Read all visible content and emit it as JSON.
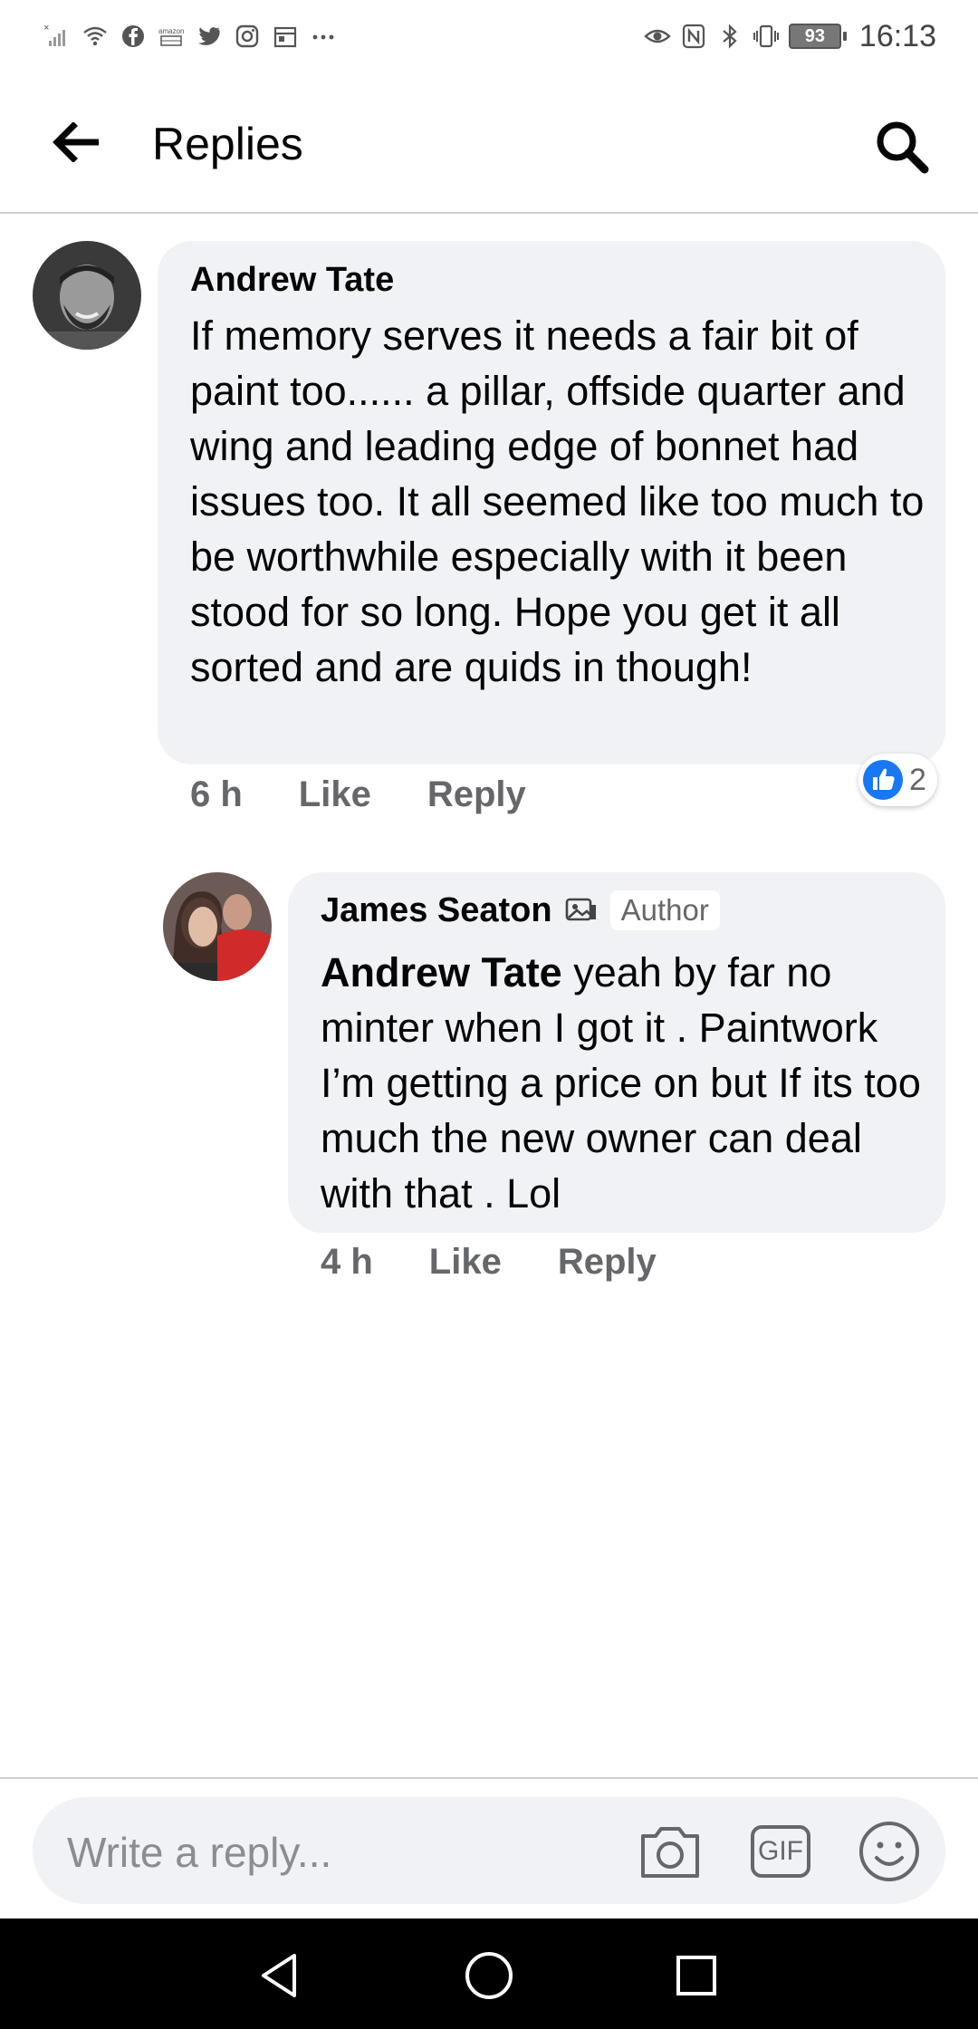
{
  "status_bar": {
    "time": "16:13",
    "battery": "93",
    "left_icons": [
      "signal-off-icon",
      "wifi-icon",
      "facebook-icon",
      "amazon-icon",
      "twitter-icon",
      "instagram-icon",
      "calendar-icon",
      "more-dots-icon"
    ],
    "right_icons": [
      "eye-icon",
      "nfc-icon",
      "bluetooth-icon",
      "vibrate-icon",
      "battery-icon"
    ]
  },
  "header": {
    "title": "Replies",
    "back_icon": "arrow-left-icon",
    "search_icon": "search-icon"
  },
  "comments": [
    {
      "author": "Andrew Tate",
      "text": "If memory serves it needs a fair bit of paint too...... a pillar, offside quarter and wing and leading edge of bonnet had issues too. It all seemed like too much to be worthwhile especially with it been stood for so long. Hope you get it all sorted and are quids in though!",
      "time": "6 h",
      "like_label": "Like",
      "reply_label": "Reply",
      "reaction_count": "2"
    },
    {
      "author": "James Seaton",
      "badge": "Author",
      "mention": "Andrew Tate",
      "text": " yeah by far no minter when I got it . Paintwork I’m getting a price on but If its too much the new owner can deal with that . Lol",
      "time": "4 h",
      "like_label": "Like",
      "reply_label": "Reply"
    }
  ],
  "composer": {
    "placeholder": "Write a reply...",
    "gif_label": "GIF"
  },
  "colors": {
    "bubble_bg": "#f0f2f5",
    "meta_text": "#65676b",
    "like_blue": "#1877f2",
    "nav_bg": "#000000"
  }
}
